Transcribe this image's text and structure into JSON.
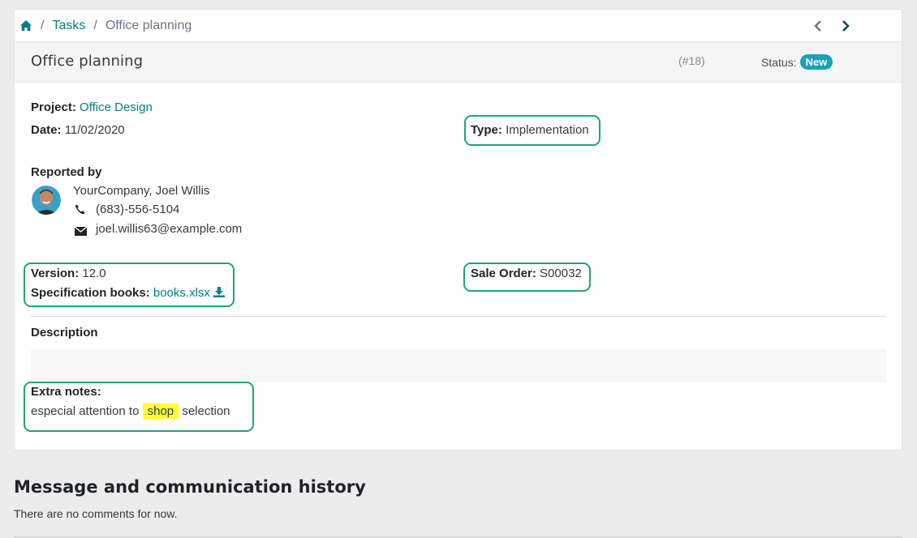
{
  "breadcrumb": {
    "tasks": "Tasks",
    "sep": "/",
    "current": "Office planning"
  },
  "header": {
    "title": "Office planning",
    "ref": "(#18)",
    "status_label": "Status:",
    "status_value": "New"
  },
  "fields": {
    "project_label": "Project:",
    "project_value": "Office Design",
    "date_label": "Date:",
    "date_value": "11/02/2020",
    "type_label": "Type:",
    "type_value": "Implementation",
    "reported_by_label": "Reported by",
    "reporter_name": "YourCompany, Joel Willis",
    "reporter_phone": "(683)-556-5104",
    "reporter_email": "joel.willis63@example.com",
    "version_label": "Version:",
    "version_value": "12.0",
    "spec_label": "Specification books:",
    "spec_value": "books.xlsx",
    "sale_order_label": "Sale Order:",
    "sale_order_value": "S00032",
    "description_label": "Description",
    "extra_notes_label": "Extra notes:",
    "extra_notes_before": "especial attention to",
    "extra_notes_highlight": "shop",
    "extra_notes_after": "selection"
  },
  "history": {
    "title": "Message and communication history",
    "empty": "There are no comments for now."
  },
  "colors": {
    "accent": "#017e84",
    "status": "#17a2b8",
    "highlight_border": "#20a37f",
    "mark": "#ffff33"
  }
}
